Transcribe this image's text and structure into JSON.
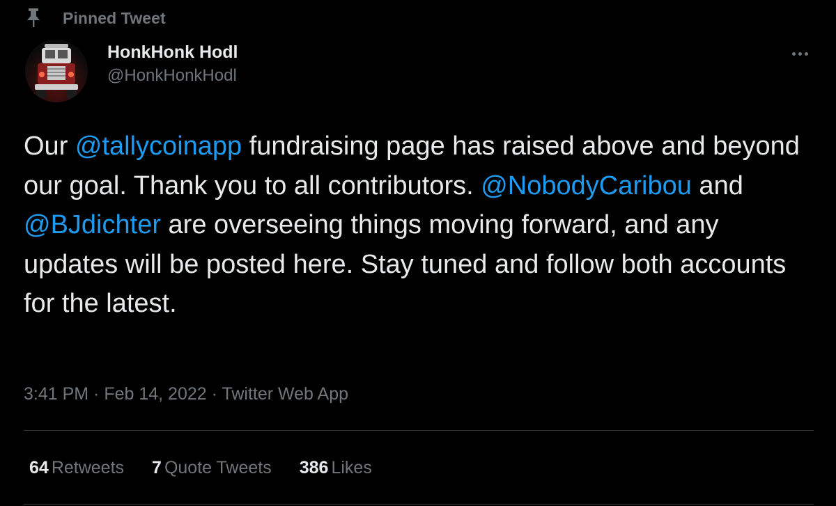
{
  "pinned": {
    "label": "Pinned Tweet",
    "icon": "pin-icon"
  },
  "author": {
    "display_name": "HonkHonk Hodl",
    "handle": "@HonkHonkHodl",
    "avatar_icon": "truck-avatar"
  },
  "more_icon": "more-horizontal-icon",
  "tweet": {
    "segments": [
      {
        "text": "Our ",
        "mention": false
      },
      {
        "text": "@tallycoinapp",
        "mention": true
      },
      {
        "text": " fundraising page has raised above and beyond our goal. Thank you to all contributors. ",
        "mention": false
      },
      {
        "text": "@NobodyCaribou",
        "mention": true
      },
      {
        "text": " and ",
        "mention": false
      },
      {
        "text": "@BJdichter",
        "mention": true
      },
      {
        "text": " are overseeing things moving forward, and any updates will be posted here. Stay tuned and follow both accounts for the latest.",
        "mention": false
      }
    ]
  },
  "meta": {
    "time": "3:41 PM",
    "separator": " · ",
    "date": "Feb 14, 2022",
    "source": "Twitter Web App"
  },
  "stats": {
    "retweets": {
      "count": "64",
      "label": "Retweets"
    },
    "quotes": {
      "count": "7",
      "label": "Quote Tweets"
    },
    "likes": {
      "count": "386",
      "label": "Likes"
    }
  },
  "colors": {
    "background": "#000000",
    "text": "#e7e9ea",
    "secondary": "#71767b",
    "accent": "#1d9bf0",
    "divider": "#2f3336"
  }
}
